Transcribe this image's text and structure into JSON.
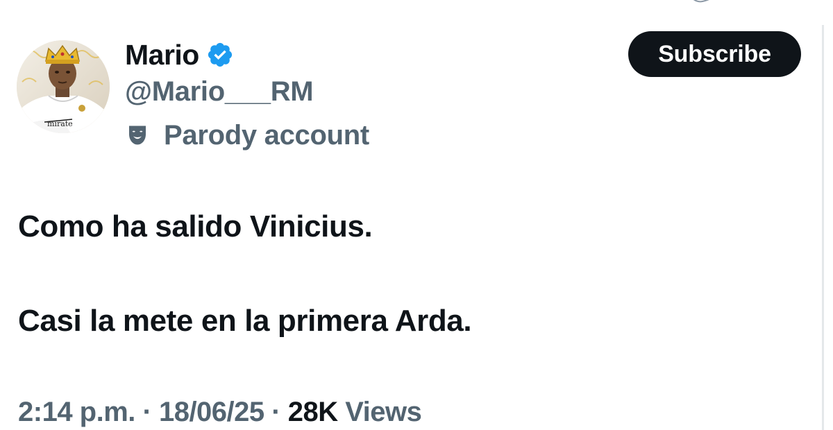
{
  "author": {
    "display_name": "Mario",
    "handle": "@Mario___RM",
    "verified": true,
    "account_label": "Parody account"
  },
  "icons": {
    "verified": "verified-badge-icon",
    "parody": "theater-mask-icon",
    "avatar_crown": "crown"
  },
  "actions": {
    "subscribe_label": "Subscribe"
  },
  "tweet": {
    "lines": [
      "Como ha salido Vinicius.",
      "Casi la mete en la primera Arda."
    ]
  },
  "meta": {
    "time": "2:14 p.m.",
    "separator": " · ",
    "date": "18/06/25",
    "views_count": "28K",
    "views_label": "Views"
  },
  "colors": {
    "text_primary": "#0f1419",
    "text_secondary": "#536471",
    "verified_blue": "#1d9bf0",
    "button_bg": "#0f1419",
    "button_text": "#ffffff"
  }
}
